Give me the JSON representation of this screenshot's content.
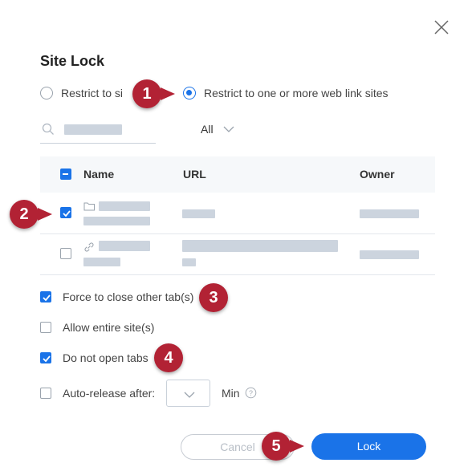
{
  "dialog": {
    "title": "Site Lock",
    "close_icon": "close-icon"
  },
  "restrict": {
    "option_all": "Restrict to si",
    "option_web": "Restrict to one or more web link sites",
    "selected": "web"
  },
  "filter": {
    "value": "All"
  },
  "table": {
    "columns": [
      "Name",
      "URL",
      "Owner"
    ],
    "rows": [
      {
        "type": "folder",
        "checked": true
      },
      {
        "type": "link",
        "checked": false
      }
    ]
  },
  "options": {
    "force_close": {
      "label": "Force to close other tab(s)",
      "checked": true
    },
    "allow_entire": {
      "label": "Allow entire site(s)",
      "checked": false
    },
    "no_open_tabs": {
      "label": "Do not open tabs",
      "checked": true
    },
    "auto_release": {
      "label": "Auto-release after:",
      "checked": false,
      "unit": "Min"
    }
  },
  "buttons": {
    "cancel": "Cancel",
    "lock": "Lock"
  },
  "badges": [
    "1",
    "2",
    "3",
    "4",
    "5"
  ],
  "colors": {
    "accent": "#1a73e8",
    "badge": "#b22234"
  }
}
